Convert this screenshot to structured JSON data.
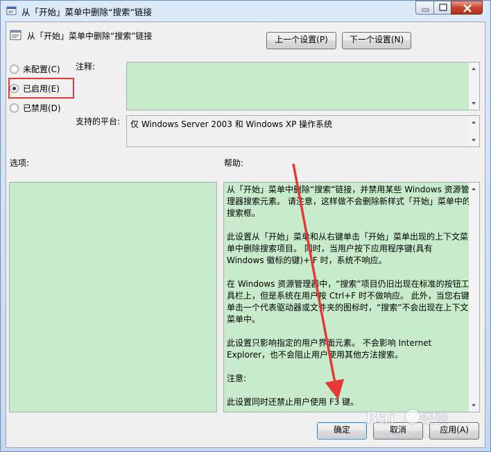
{
  "window": {
    "title": "从「开始」菜单中删除“搜索”链接",
    "controls": {
      "minimize": "minimize",
      "maximize": "maximize",
      "close": "close"
    }
  },
  "header": {
    "policy_name": "从「开始」菜单中删除“搜索”链接",
    "prev_button": "上一个设置(P)",
    "next_button": "下一个设置(N)"
  },
  "state": {
    "options": [
      {
        "label": "未配置(C)",
        "selected": false
      },
      {
        "label": "已启用(E)",
        "selected": true
      },
      {
        "label": "已禁用(D)",
        "selected": false
      }
    ]
  },
  "comment": {
    "label": "注释:",
    "value": ""
  },
  "platform": {
    "label": "支持的平台:",
    "value": "仅 Windows Server 2003 和 Windows XP 操作系统"
  },
  "options_section": {
    "label": "选项:"
  },
  "help_section": {
    "label": "帮助:",
    "paragraphs": [
      "从「开始」菜单中删除“搜索”链接，并禁用某些 Windows 资源管理器搜索元素。  请注意，这样做不会删除新样式「开始」菜单中的搜索框。",
      "此设置从「开始」菜单和从右键单击「开始」菜单出现的上下文菜单中删除搜索项目。 同时，当用户按下应用程序键(具有 Windows 徽标的键)+ F 时，系统不响应。",
      "在 Windows 资源管理器中，“搜索”项目仍旧出现在标准的按钮工具栏上，但是系统在用户按 Ctrl+F 时不做响应。 此外，当您右键单击一个代表驱动器或文件夹的图标时，“搜索”不会出现在上下文菜单中。",
      "此设置只影响指定的用户界面元素。 不会影响 Internet Explorer，也不会阻止用户使用其他方法搜索。",
      "注意:",
      "此设置同时还禁止用户使用 F3 键。"
    ]
  },
  "footer": {
    "ok": "确定",
    "cancel": "取消",
    "apply": "应用(A)"
  },
  "watermark": "Baidu 经验 jingyan.baidu.com",
  "colors": {
    "field_green": "#c8ebcb",
    "annotation_red": "#e53935"
  }
}
